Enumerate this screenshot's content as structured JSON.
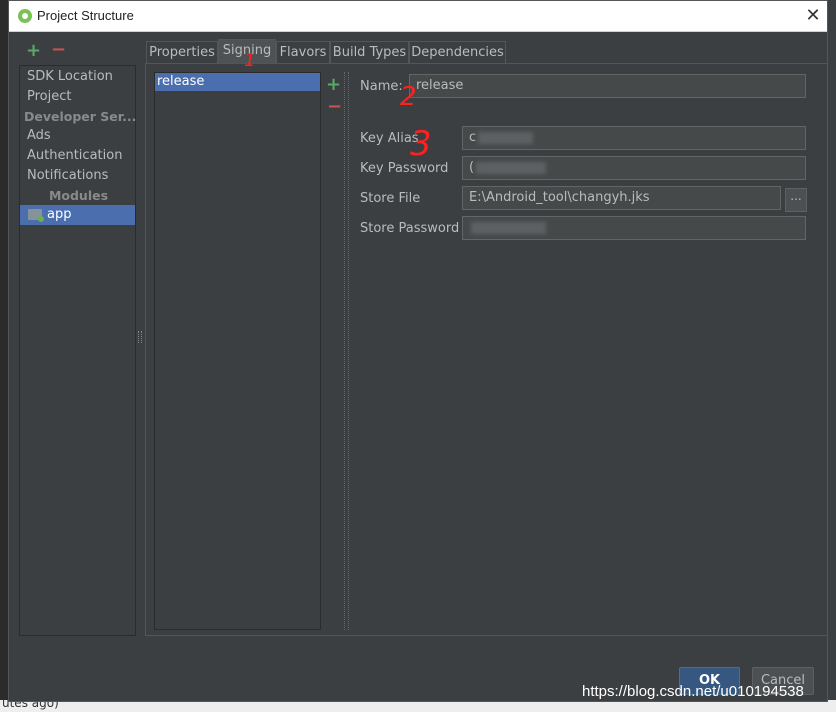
{
  "window": {
    "title": "Project Structure",
    "close_symbol": "✕"
  },
  "background": {
    "bottom_text": "utes ago)"
  },
  "toolbar": {
    "add_symbol": "+",
    "remove_symbol": "−"
  },
  "sidebar": {
    "items": [
      {
        "label": "SDK Location"
      },
      {
        "label": "Project"
      }
    ],
    "developer_services_header": "Developer Ser... ",
    "developer_services": [
      {
        "label": "Ads"
      },
      {
        "label": "Authentication"
      },
      {
        "label": "Notifications"
      }
    ],
    "modules_header": "Modules",
    "module_selected": "app"
  },
  "tabs": [
    {
      "label": "Properties",
      "active": false
    },
    {
      "label": "Signing",
      "active": true
    },
    {
      "label": "Flavors",
      "active": false
    },
    {
      "label": "Build Types",
      "active": false
    },
    {
      "label": "Dependencies",
      "active": false
    }
  ],
  "signing": {
    "configs": [
      "release"
    ],
    "add_symbol": "+",
    "remove_symbol": "−",
    "name_label": "Name:",
    "name_value": "release",
    "key_alias_label": "Key Alias",
    "key_alias_value": "c",
    "key_password_label": "Key Password",
    "key_password_value": "(",
    "store_file_label": "Store File",
    "store_file_value": "E:\\Android_tool\\changyh.jks",
    "browse_label": "...",
    "store_password_label": "Store Password",
    "store_password_value": ""
  },
  "footer": {
    "ok_label": "OK",
    "cancel_label": "Cancel"
  },
  "annotations": [
    "1",
    "2",
    "3"
  ],
  "watermark": "https://blog.csdn.net/u010194538",
  "colors": {
    "accent_selection": "#4b6eaf",
    "add_green": "#59a869",
    "remove_red": "#c75450",
    "annotation_red": "#ff2020",
    "ok_blue": "#365880"
  }
}
